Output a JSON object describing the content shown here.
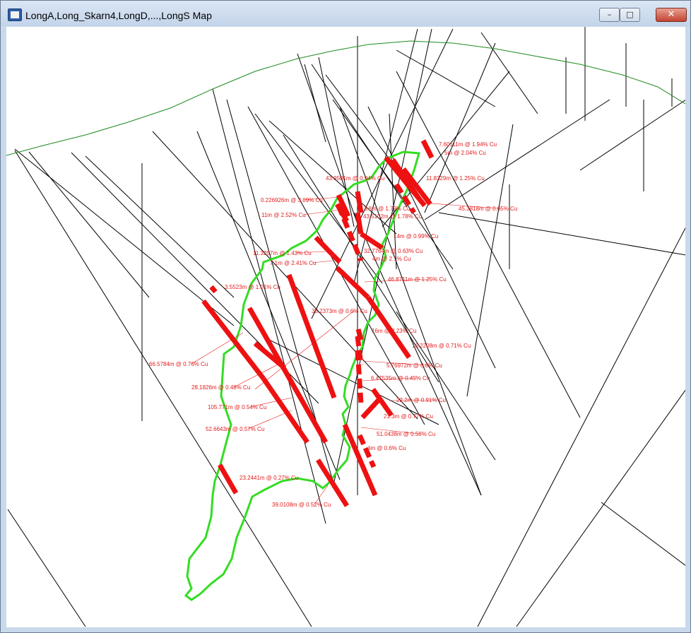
{
  "window": {
    "title": "LongA,Long_Skarn4,LongD,...,LongS Map",
    "buttons": {
      "minimize": "–",
      "maximize": "□",
      "close": "✕"
    }
  },
  "colors": {
    "topography": "#1f8a1f",
    "outline": "#33dd22",
    "intercept": "#ee1111",
    "label": "#e31a1a",
    "drillhole": "#000000"
  },
  "intercepts": [
    {
      "label": "7.60111m @ 1.94% Cu"
    },
    {
      "label": "5m @ 2.04% Cu"
    },
    {
      "label": "43.9501m @ 0.94% Cu"
    },
    {
      "label": "11.8329m @ 1.25% Cu"
    },
    {
      "label": "0.226926m @ 3.09% Cu"
    },
    {
      "label": "45.3818m @ 0.65% Cu"
    },
    {
      "label": "11m @ 2.52% Cu"
    },
    {
      "label": "3.8m @ 1.79% Cu"
    },
    {
      "label": "43.5102m @ 1.78% Cu"
    },
    {
      "label": "14m @ 0.99% Cu"
    },
    {
      "label": "32.7764m @ 0.63% Cu"
    },
    {
      "label": "11.3257m @ 1.43% Cu"
    },
    {
      "label": "7.1m @ 2.41% Cu"
    },
    {
      "label": "4m @ 2.1% Cu"
    },
    {
      "label": "46.8711m @ 1.25% Cu"
    },
    {
      "label": "3.5523m @ 1.01% Cu"
    },
    {
      "label": "38.2373m @ 0.6% Cu"
    },
    {
      "label": "16m @ 2.23% Cu"
    },
    {
      "label": "16.2208m @ 0.71% Cu"
    },
    {
      "label": "66.5784m @ 0.76% Cu"
    },
    {
      "label": "5.76972m @ 0.8% Cu"
    },
    {
      "label": "28.1826m @ 0.48% Cu"
    },
    {
      "label": "6.47535m @ 0.49% Cu"
    },
    {
      "label": "22.2m @ 0.91% Cu"
    },
    {
      "label": "105.771m @ 0.54% Cu"
    },
    {
      "label": "21.3m @ 0.77% Cu"
    },
    {
      "label": "52.6643m @ 0.57% Cu"
    },
    {
      "label": "51.0438m @ 0.58% Cu"
    },
    {
      "label": "4m @ 0.6% Cu"
    },
    {
      "label": "23.2441m @ 0.27% Cu"
    },
    {
      "label": "39.0108m @ 0.52% Cu"
    }
  ]
}
